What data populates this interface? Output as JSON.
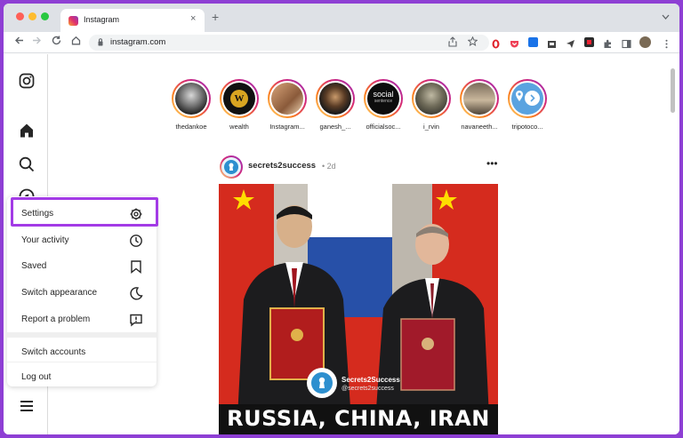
{
  "browser": {
    "tab_title": "Instagram",
    "tab_close": "×",
    "new_tab": "+",
    "url": "instagram.com",
    "icons": [
      "back-arrow-icon",
      "forward-arrow-icon",
      "reload-icon",
      "home-icon",
      "lock-icon",
      "share-icon",
      "bookmark-star-icon",
      "extensions-icon",
      "sidebar-icon",
      "profile-icon",
      "kebab-menu-icon"
    ]
  },
  "stories": [
    {
      "name": "thedankoe"
    },
    {
      "name": "wealth"
    },
    {
      "name": "Instagram..."
    },
    {
      "name": "ganesh_..."
    },
    {
      "name": "officialsoc..."
    },
    {
      "name": "i_rvin"
    },
    {
      "name": "navaneeth..."
    },
    {
      "name": "tripotoco..."
    }
  ],
  "story_logos": {
    "wealth": "W",
    "social": "social",
    "social_sub": "sentence"
  },
  "post": {
    "username": "secrets2success",
    "time": "• 2d",
    "more": "•••",
    "watermark_name": "Secrets2Success",
    "watermark_handle": "@secrets2success",
    "caption": "RUSSIA, CHINA, IRAN AND"
  },
  "menu": {
    "items": [
      {
        "label": "Settings",
        "icon": "settings-gear-icon"
      },
      {
        "label": "Your activity",
        "icon": "activity-clock-icon"
      },
      {
        "label": "Saved",
        "icon": "saved-bookmark-icon"
      },
      {
        "label": "Switch appearance",
        "icon": "moon-icon"
      },
      {
        "label": "Report a problem",
        "icon": "report-problem-icon"
      }
    ],
    "switch_accounts": "Switch accounts",
    "log_out": "Log out"
  },
  "colors": {
    "highlight": "#a33be6",
    "story_ring": "#d62976",
    "background": "#8e3fd4"
  }
}
